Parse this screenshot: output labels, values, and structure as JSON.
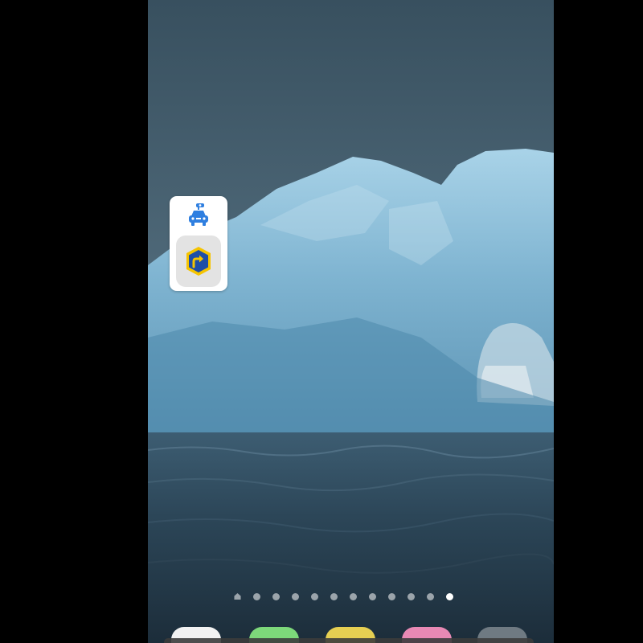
{
  "launcher": {
    "items": [
      {
        "icon": "car-roof-luggage-icon",
        "color": "#2f7fe0"
      },
      {
        "icon": "yellow-direction-arrow-icon",
        "color": "#f5c400"
      }
    ]
  },
  "page_indicator": {
    "count": 11,
    "active_index": 10,
    "home_icon": "home-icon"
  },
  "dock": {
    "colors": [
      "#f2f2f2",
      "#7dd87a",
      "#e6cf52",
      "#e889b4",
      "#6f7a82"
    ]
  }
}
